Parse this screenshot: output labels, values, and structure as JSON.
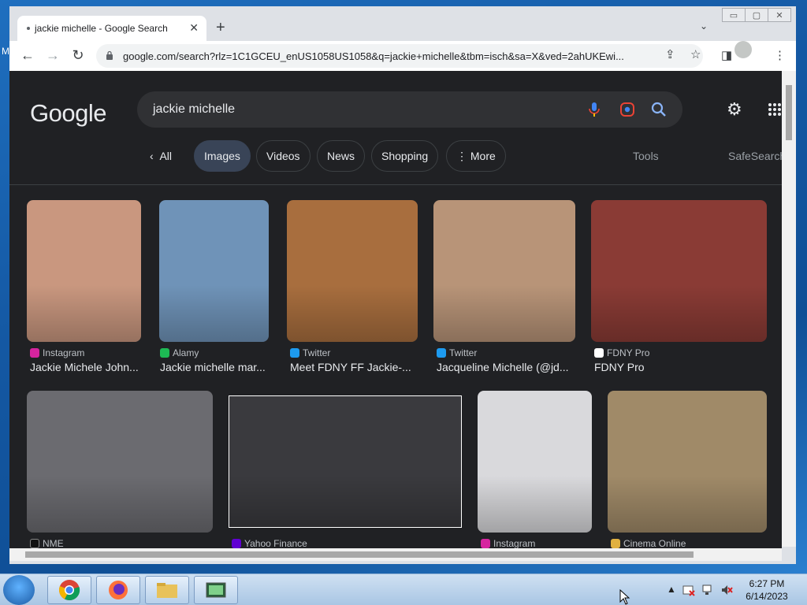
{
  "desktop": {
    "letter": "M"
  },
  "window": {
    "controls": [
      "▭",
      "▢",
      "✕"
    ],
    "tab": {
      "title": "jackie michelle - Google Search",
      "close": "✕"
    },
    "new_tab": "+",
    "tab_dropdown": "⌄"
  },
  "toolbar": {
    "back": "←",
    "forward": "→",
    "reload": "↻",
    "url": "google.com/search?rlz=1C1GCEU_enUS1058US1058&q=jackie+michelle&tbm=isch&sa=X&ved=2ahUKEwi...",
    "share": "⇪",
    "star": "☆",
    "sidepanel": "◨",
    "menu": "⋮"
  },
  "google": {
    "logo": "Google",
    "query": "jackie michelle",
    "settings": "⚙",
    "apps": "⋮⋮⋮",
    "tabs": {
      "all": "All",
      "images": "Images",
      "videos": "Videos",
      "news": "News",
      "shopping": "Shopping",
      "more": "More",
      "tools": "Tools",
      "safesearch": "SafeSearch"
    }
  },
  "results_row1": [
    {
      "source": "Instagram",
      "title": "Jackie Michele John...",
      "color": "#c9977f"
    },
    {
      "source": "Alamy",
      "title": "Jackie michelle mar...",
      "color": "#6f93b8"
    },
    {
      "source": "Twitter",
      "title": "Meet FDNY FF Jackie-...",
      "color": "#a86e3e"
    },
    {
      "source": "Twitter",
      "title": "Jacqueline Michelle (@jd...",
      "color": "#b89478"
    },
    {
      "source": "FDNY Pro",
      "title": "FDNY Pro",
      "color": "#8a3b35"
    }
  ],
  "results_row2": [
    {
      "source": "NME",
      "color": "#6b6b70"
    },
    {
      "source": "Yahoo Finance",
      "color": "#3a3a3e"
    },
    {
      "source": "Instagram",
      "color": "#d9d9dc"
    },
    {
      "source": "Cinema Online",
      "color": "#a08a68"
    }
  ],
  "taskbar": {
    "time": "6:27 PM",
    "date": "6/14/2023",
    "tray_arrow": "▲"
  }
}
